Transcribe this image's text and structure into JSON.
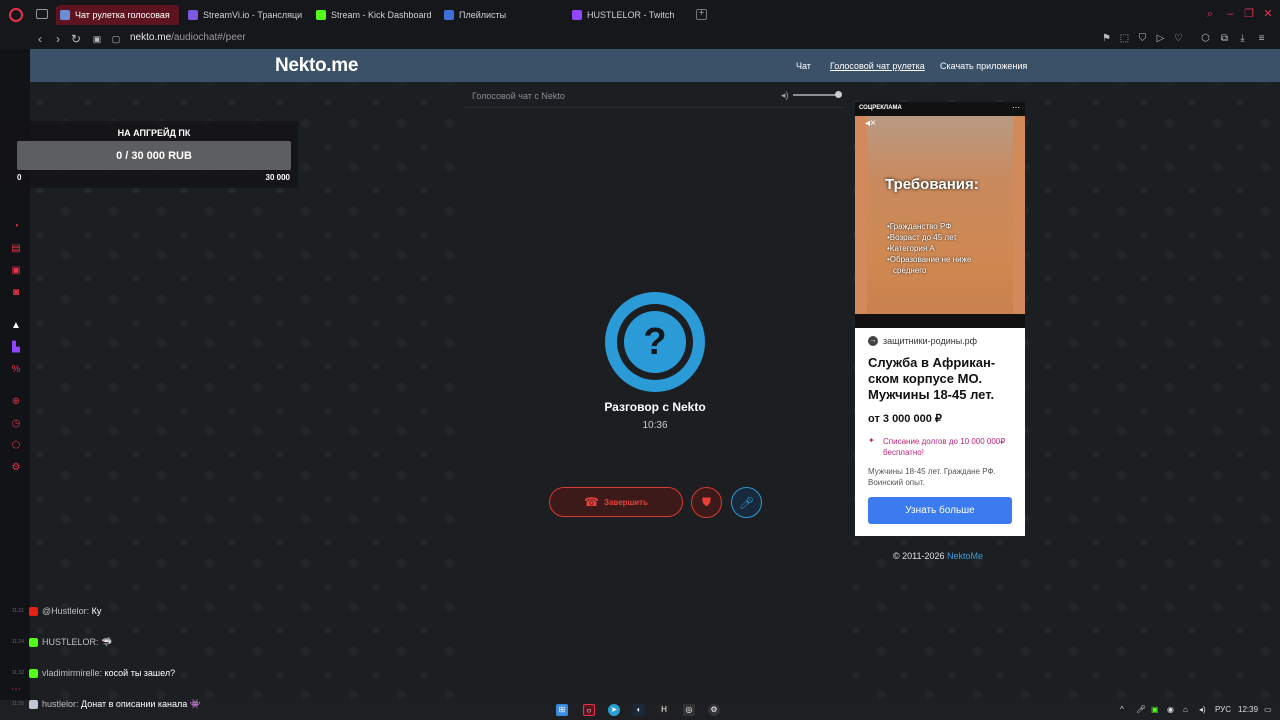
{
  "browser": {
    "tabs": [
      {
        "label": "Чат рулетка голосовая",
        "active": true,
        "icon_color": "#6c8cd5"
      },
      {
        "label": "StreamVi.io - Трансляции",
        "active": false,
        "icon_color": "#7b5ae0"
      },
      {
        "label": "Stream - Kick Dashboard",
        "active": false,
        "icon_color": "#53fc18"
      },
      {
        "label": "Плейлисты",
        "active": false,
        "icon_color": "#3f6fd8"
      },
      {
        "label": "HUSTLELOR - Twitch",
        "active": false,
        "icon_color": "#9146ff"
      }
    ],
    "url_host": "nekto.me",
    "url_path": "/audiochat#/peer"
  },
  "site": {
    "brand": "Nekto.me",
    "menu": [
      {
        "label": "Чат",
        "active": false
      },
      {
        "label": "Голосовой чат рулетка",
        "active": true
      },
      {
        "label": "Скачать приложения",
        "active": false
      }
    ]
  },
  "donation": {
    "title": "НА АПГРЕЙД ПК",
    "value_text": "0 / 30 000 RUB",
    "progress": 0,
    "min_label": "0",
    "max_label": "30 000"
  },
  "call": {
    "header_title": "Голосовой чат с Nekto",
    "volume": 1.0,
    "avatar_glyph": "?",
    "peer_name": "Разговор с Nekto",
    "timer": "10:36",
    "end_label": "Завершить",
    "accent_blue": "#2b9bd8",
    "accent_red": "#e8413a"
  },
  "ad": {
    "label": "СОЦРЕКЛАМА",
    "video_title": "Требования:",
    "requirements": [
      "•Гражданство РФ",
      "•Возраст до 45 лет",
      "•Категория А",
      "•Образование не ниже",
      "среднего"
    ],
    "domain": "защитники-родины.рф",
    "headline": "Служба в Африкан-ском корпусе МО. Мужчины 18-45 лет.",
    "price": "от 3 000 000 ₽",
    "promo": "Списание долгов до 10 000 000₽ бесплатно!",
    "description": "Мужчины 18-45 лет. Граждане РФ. Воинский опыт.",
    "cta": "Узнать больше"
  },
  "footer": {
    "copyright": "© 2011-2026",
    "link": "NektoMe"
  },
  "chat": [
    {
      "time": "11:21",
      "platform": "youtube",
      "badge_color": "#e62117",
      "user": "@Hustlelor:",
      "message": "Ку"
    },
    {
      "time": "11:24",
      "platform": "kick",
      "badge_color": "#53fc18",
      "user": "HUSTLELOR:",
      "message": "🦈"
    },
    {
      "time": "11:32",
      "platform": "kick",
      "badge_color": "#53fc18",
      "user": "vladimirmirelle:",
      "message": "косой ты зашел?"
    },
    {
      "time": "11:35",
      "platform": "vk",
      "badge_color": "#bfc7d6",
      "user": "hustlelor:",
      "message": "Донат в описании канала 👾"
    }
  ],
  "taskbar": {
    "lang": "РУС",
    "clock": "12:39"
  }
}
